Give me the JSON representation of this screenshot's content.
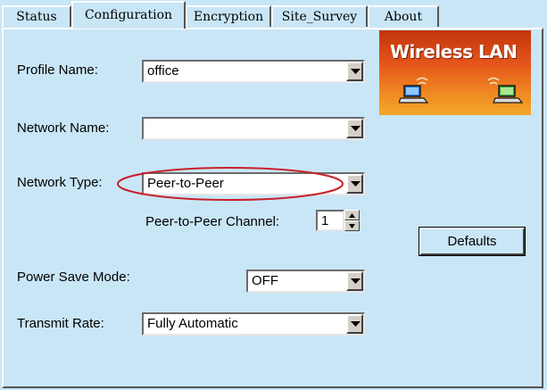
{
  "tabs": [
    {
      "label": "Status"
    },
    {
      "label": "Configuration"
    },
    {
      "label": "Encryption"
    },
    {
      "label": "Site_Survey"
    },
    {
      "label": "About"
    }
  ],
  "active_tab": "Configuration",
  "logo": {
    "text": "Wireless LAN"
  },
  "form": {
    "profile_name": {
      "label": "Profile Name:",
      "value": "office"
    },
    "network_name": {
      "label": "Network Name:",
      "value": ""
    },
    "network_type": {
      "label": "Network Type:",
      "value": "Peer-to-Peer"
    },
    "channel": {
      "label": "Peer-to-Peer Channel:",
      "value": "1"
    },
    "power_save": {
      "label": "Power Save Mode:",
      "value": "OFF"
    },
    "transmit_rate": {
      "label": "Transmit Rate:",
      "value": "Fully Automatic"
    }
  },
  "buttons": {
    "defaults": "Defaults"
  },
  "colors": {
    "panel_bg": "#c9e6f7",
    "highlight_ellipse": "#c8202a",
    "logo_gradient_top": "#c2340a",
    "logo_gradient_bottom": "#f4a72a"
  }
}
